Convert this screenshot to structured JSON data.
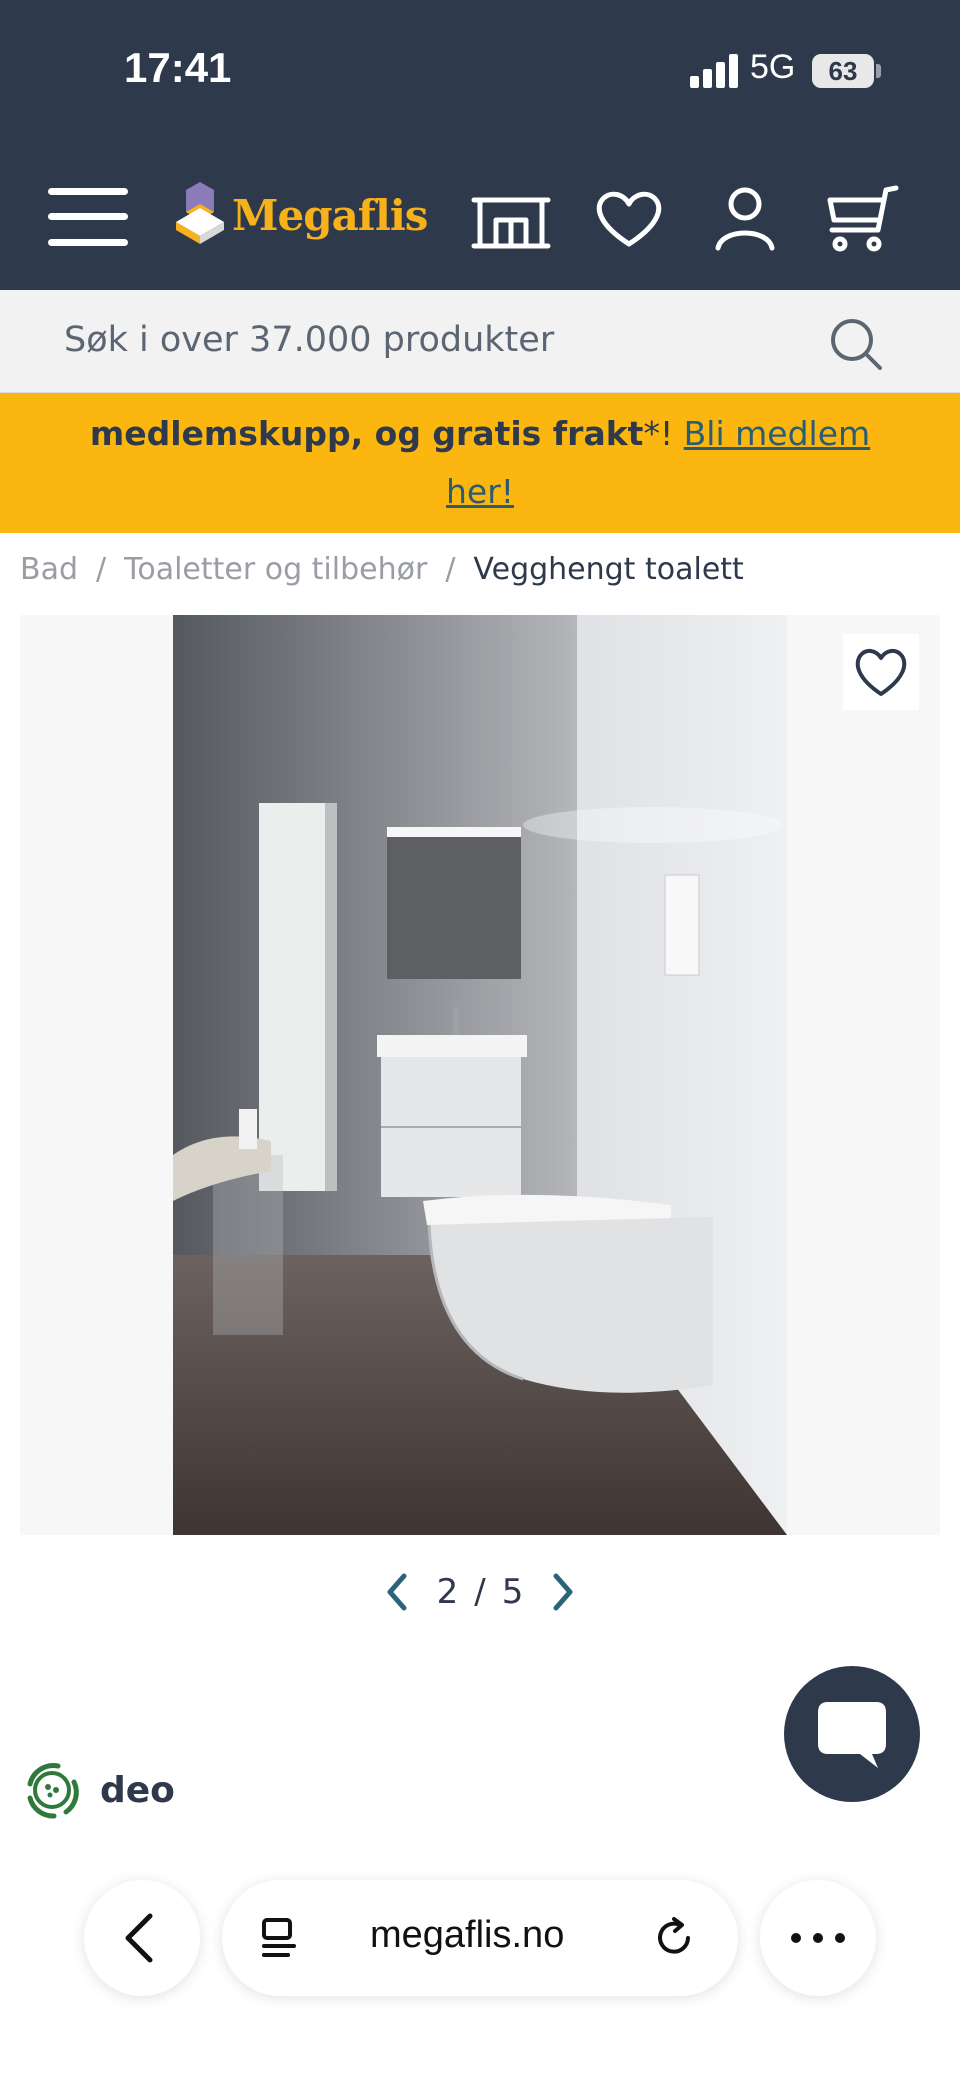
{
  "status": {
    "time": "17:41",
    "network": "5G",
    "battery": "63"
  },
  "header": {
    "logo_text": "Megaflis",
    "icons": [
      "menu-icon",
      "store-icon",
      "heart-icon",
      "user-icon",
      "cart-icon"
    ],
    "colors": {
      "background": "#2e3a4b",
      "brand": "#f7b21b"
    }
  },
  "search": {
    "placeholder": "Søk i over 37.000 produkter"
  },
  "promo": {
    "text": "medlemskupp, og gratis frakt",
    "asterisk": "*!",
    "link_part1": "Bli medlem",
    "link_part2": "her!",
    "color": "#fbb70f"
  },
  "breadcrumb": {
    "items": [
      "Bad",
      "Toaletter og tilbehør",
      "Vegghengt toalett"
    ],
    "separator": "/"
  },
  "gallery": {
    "current": "2",
    "separator": "/",
    "total": "5"
  },
  "deo": {
    "label": "deo"
  },
  "browser": {
    "url": "megaflis.no"
  }
}
